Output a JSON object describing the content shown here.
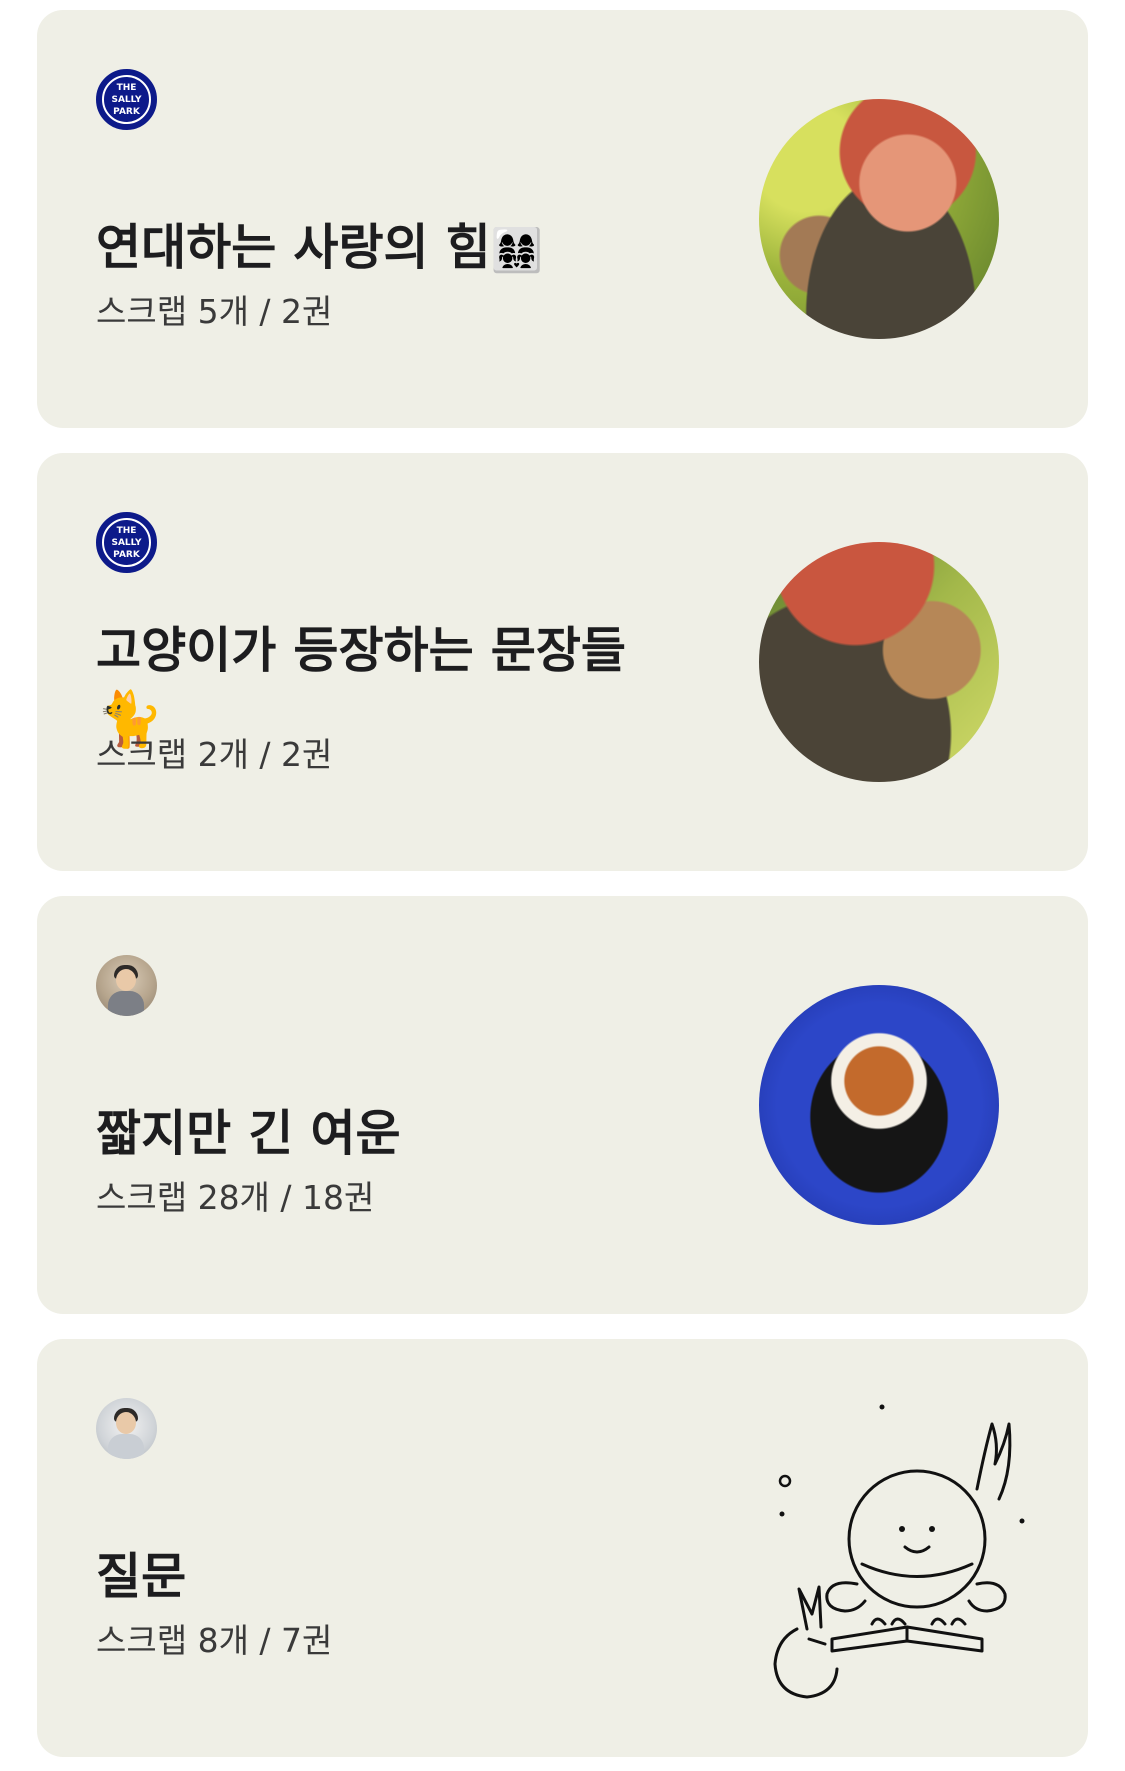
{
  "cards": [
    {
      "author_avatar": {
        "type": "logo",
        "logo_text": [
          "THE",
          "SALLY",
          "PARK"
        ]
      },
      "title": "연대하는 사랑의 힘",
      "title_emoji": "👩‍👩‍👧‍👧",
      "meta": "스크랩 5개 / 2권",
      "thumbnail_icon": "woman-with-cat-photo"
    },
    {
      "author_avatar": {
        "type": "logo",
        "logo_text": [
          "THE",
          "SALLY",
          "PARK"
        ]
      },
      "title": "고양이가 등장하는 문장들",
      "title_emoji": "🐈",
      "meta": "스크랩 2개 / 2권",
      "thumbnail_icon": "woman-hugging-cat-photo"
    },
    {
      "author_avatar": {
        "type": "photo",
        "icon": "user-avatar-man"
      },
      "title": "짧지만 긴 여운",
      "title_emoji": "",
      "meta": "스크랩 28개 / 18권",
      "thumbnail_icon": "espresso-cup-photo"
    },
    {
      "author_avatar": {
        "type": "photo",
        "icon": "user-avatar-woman"
      },
      "title": "질문",
      "title_emoji": "",
      "meta": "스크랩 8개 / 7권",
      "thumbnail_icon": "cartoon-reading-illustration"
    }
  ],
  "colors": {
    "card_bg": "#efefe6",
    "logo_blue": "#0d1a8a",
    "text": "#1d1d1f"
  }
}
